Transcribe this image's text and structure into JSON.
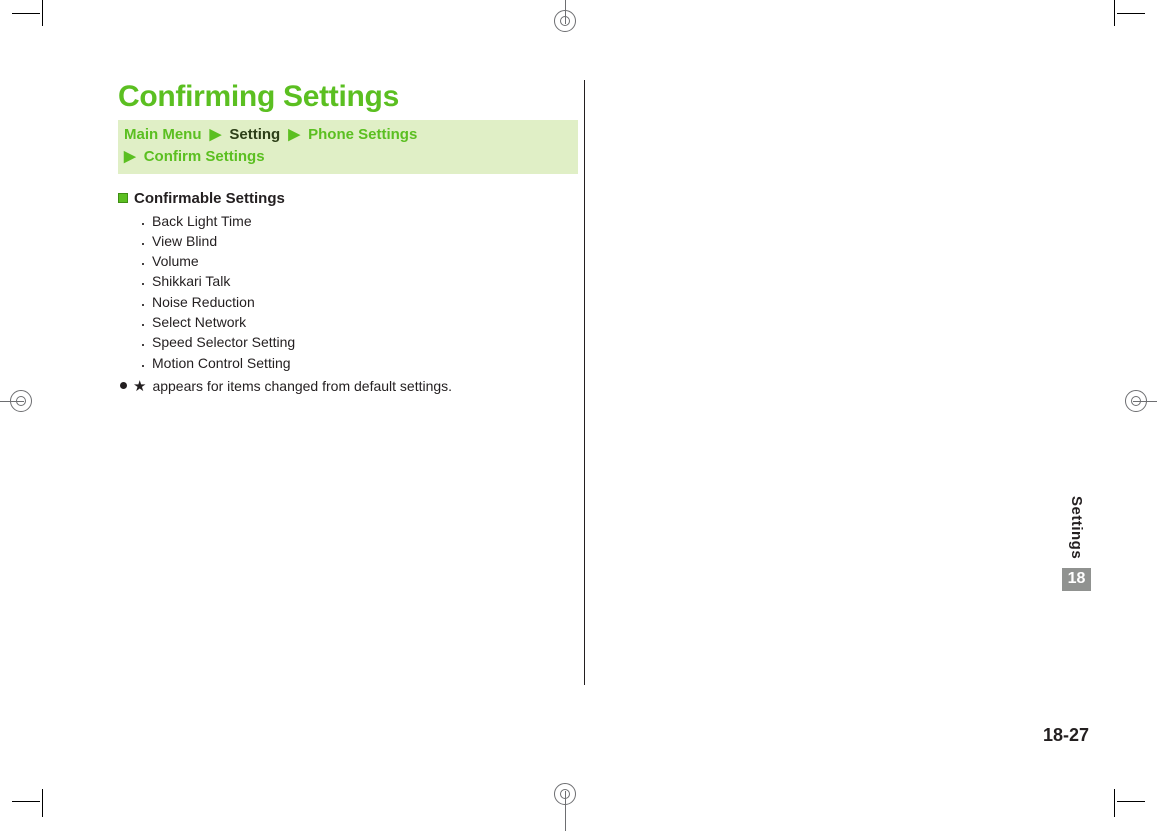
{
  "page": {
    "title": "Confirming Settings",
    "breadcrumb": {
      "items": [
        {
          "label": "Main Menu",
          "dark": false
        },
        {
          "label": "Setting",
          "dark": true
        },
        {
          "label": "Phone Settings",
          "dark": false
        },
        {
          "label": "Confirm Settings",
          "dark": false
        }
      ],
      "sep": "▶"
    },
    "section_heading": "Confirmable Settings",
    "settings_list": [
      "Back Light Time",
      "View Blind",
      "Volume",
      "Shikkari Talk",
      "Noise Reduction",
      "Select Network",
      "Speed Selector Setting",
      "Motion Control Setting"
    ],
    "note": {
      "star": "★",
      "text": "appears for items changed from default settings."
    }
  },
  "sidebar": {
    "label": "Settings",
    "chapter": "18"
  },
  "page_number": "18-27"
}
